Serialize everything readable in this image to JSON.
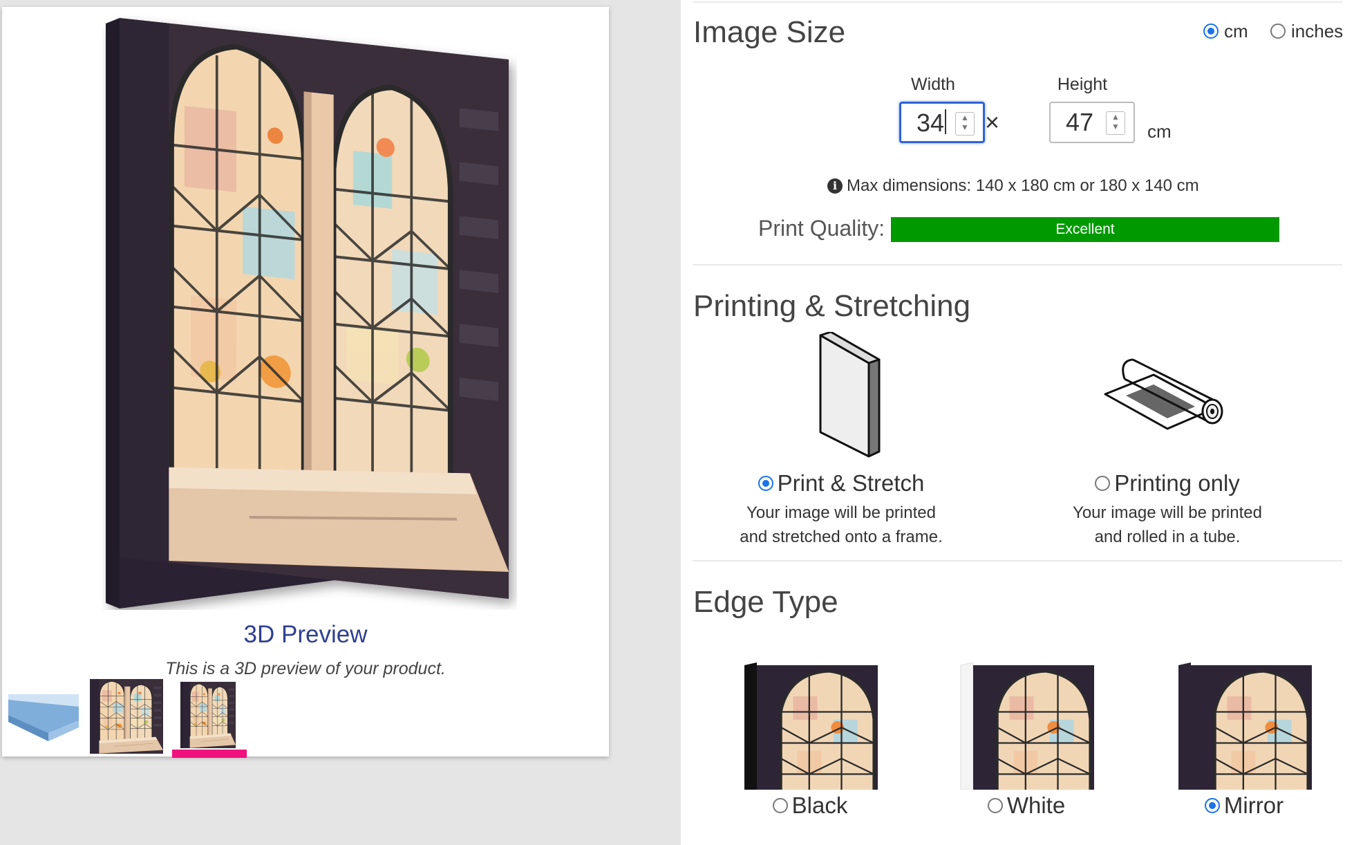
{
  "preview": {
    "title": "3D Preview",
    "caption": "This is a 3D preview of your product.",
    "thumbnails": [
      "acrylic-block-thumbnail",
      "flat-print-thumbnail",
      "canvas-3d-thumbnail"
    ],
    "active_thumbnail_index": 2
  },
  "image_size": {
    "title": "Image Size",
    "units": [
      {
        "label": "cm",
        "selected": true
      },
      {
        "label": "inches",
        "selected": false
      }
    ],
    "width_label": "Width",
    "height_label": "Height",
    "width_value": "34",
    "height_value": "47",
    "times": "×",
    "unit_suffix": "cm",
    "max_dimensions": "Max dimensions: 140 x 180 cm or 180 x 140 cm",
    "quality_label": "Print Quality:",
    "quality_value": "Excellent",
    "quality_color": "#009a00"
  },
  "printing": {
    "title": "Printing & Stretching",
    "options": [
      {
        "title": "Print & Stretch",
        "desc_line1": "Your image will be printed",
        "desc_line2": "and stretched onto a frame.",
        "selected": true,
        "icon": "stretched-canvas-icon"
      },
      {
        "title": "Printing only",
        "desc_line1": "Your image will be printed",
        "desc_line2": "and rolled in a tube.",
        "selected": false,
        "icon": "rolled-print-icon"
      }
    ]
  },
  "edge": {
    "title": "Edge Type",
    "options": [
      {
        "label": "Black",
        "selected": false
      },
      {
        "label": "White",
        "selected": false
      },
      {
        "label": "Mirror",
        "selected": true
      }
    ]
  },
  "colors": {
    "accent": "#1a73e8",
    "preview_title": "#2e3f8f",
    "active_thumb": "#f0127e"
  }
}
